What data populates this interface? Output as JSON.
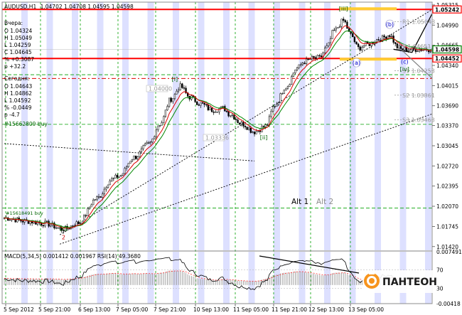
{
  "header": {
    "symbol": "AUDUSD,H1",
    "ohlc": "1.04702 1.04708 1.04595 1.04598"
  },
  "side_info": {
    "yesterday_label": "Вчера:",
    "yesterday": [
      "O 1.04324",
      "H 1.05049",
      "L 1.04259",
      "C 1.04645",
      "% +0.3087",
      "p +32.2"
    ],
    "today_label": "Сегодня:",
    "today": [
      "O 1.04643",
      "H 1.04862",
      "L 1.04592",
      "% -0.0449",
      "p -4.7"
    ],
    "order": "#15662809 buy",
    "order_small": "#15618491 buy",
    "box1": "1.04000",
    "box2": "1.03336"
  },
  "pivots": [
    {
      "label": "R1 1.05043",
      "value": 1.05043
    },
    {
      "label": "P 1.04651",
      "value": 1.04651
    },
    {
      "label": "S1 1.04253",
      "value": 1.04253
    },
    {
      "label": "S2 1.03861",
      "value": 1.03861
    },
    {
      "label": "S3 1.03463",
      "value": 1.03463
    }
  ],
  "waves": [
    {
      "text": "[i]",
      "color": "#006400",
      "bar": 92,
      "price": 1.0409
    },
    {
      "text": "[ii]",
      "color": "#006400",
      "bar": 140,
      "price": 1.0315
    },
    {
      "text": "[iii]",
      "color": "#006400",
      "bar": 183,
      "price": 1.0522
    },
    {
      "text": "(a)",
      "color": "#0000cc",
      "bar": 190,
      "price": 1.0435,
      "circle": true
    },
    {
      "text": "(b)",
      "color": "#0000cc",
      "bar": 208,
      "price": 1.0497,
      "circle": true
    },
    {
      "text": "(c)",
      "color": "#0000cc",
      "bar": 216,
      "price": 1.0437
    },
    {
      "text": "[iv]",
      "color": "#006400",
      "bar": 216,
      "price": 1.0425
    },
    {
      "text": "[c]",
      "color": "#006400",
      "bar": 32,
      "price": 1.0168
    },
    {
      "text": "2",
      "color": "#cc0000",
      "bar": 32,
      "price": 1.0154
    }
  ],
  "alt_labels": [
    {
      "text": "Alt 1",
      "color": "#000000"
    },
    {
      "text": "Alt 2",
      "color": "#8c8c8c"
    }
  ],
  "indicator_label": "MACD(5,34,5) 0.001412 0.001967  RSI(14) 49.3680",
  "logo_text": "ПАНТЕОН",
  "colors": {
    "bull_candle": "#ffffff",
    "bear_candle": "#000000",
    "ma_fast": "#dd0000",
    "ma_slow": "#008800",
    "resistance": "#ff0000",
    "bid_box": "#008000",
    "highlight": "#ffcc33",
    "session_band": "#dde0ff",
    "logo_orange": "#f7941d"
  },
  "chart_data": {
    "type": "candlestick",
    "symbol": "AUDUSD",
    "timeframe": "H1",
    "ylim": [
      1.0136,
      1.0536
    ],
    "y_ticks": [
      1.05315,
      1.0499,
      1.04665,
      1.0434,
      1.04015,
      1.0369,
      1.0337,
      1.03045,
      1.0272,
      1.02395,
      1.0207,
      1.01745,
      1.0142
    ],
    "x_ticks": [
      "5 Sep 2012",
      "5 Sep 21:00",
      "6 Sep 13:00",
      "7 Sep 05:00",
      "7 Sep 21:00",
      "10 Sep 13:00",
      "11 Sep 05:00",
      "11 Sep 21:00",
      "12 Sep 13:00",
      "13 Sep 05:00"
    ],
    "price_tags": [
      {
        "value": 1.05242,
        "label": "1.05242",
        "color": "#ff0000"
      },
      {
        "value": 1.04598,
        "label": "1.04598",
        "color": "#008000"
      },
      {
        "value": 1.04452,
        "label": "1.04452",
        "color": "#ff0000"
      }
    ],
    "horizontal_levels": [
      1.05242,
      1.04452
    ],
    "dashed_red_level": 1.0413,
    "green_dashed_levels": [
      1.0419,
      1.0339,
      1.0204
    ],
    "channel_upper": {
      "from": [
        30,
        1.0161
      ],
      "to": [
        232,
        1.0526
      ]
    },
    "channel_lower": {
      "from": [
        30,
        1.0146
      ],
      "to": [
        232,
        1.0357
      ]
    },
    "dotted_line": {
      "from": [
        0,
        1.0308
      ],
      "to": [
        135,
        1.028
      ]
    },
    "forecast_path": [
      [
        210,
        1.046
      ],
      [
        220,
        1.0455
      ],
      [
        232,
        1.0524
      ]
    ],
    "forecast_alt": [
      [
        214,
        1.046
      ],
      [
        232,
        1.041
      ]
    ],
    "anchor_points": [
      [
        0,
        1.0188
      ],
      [
        12,
        1.0183
      ],
      [
        22,
        1.0179
      ],
      [
        32,
        1.017
      ],
      [
        40,
        1.018
      ],
      [
        50,
        1.022
      ],
      [
        58,
        1.025
      ],
      [
        62,
        1.0256
      ],
      [
        70,
        1.0286
      ],
      [
        78,
        1.0307
      ],
      [
        84,
        1.034
      ],
      [
        90,
        1.038
      ],
      [
        95,
        1.04
      ],
      [
        100,
        1.0383
      ],
      [
        106,
        1.0372
      ],
      [
        112,
        1.0362
      ],
      [
        118,
        1.0365
      ],
      [
        122,
        1.0355
      ],
      [
        128,
        1.034
      ],
      [
        135,
        1.0327
      ],
      [
        141,
        1.0336
      ],
      [
        146,
        1.037
      ],
      [
        152,
        1.04
      ],
      [
        158,
        1.043
      ],
      [
        162,
        1.044
      ],
      [
        166,
        1.0445
      ],
      [
        170,
        1.0446
      ],
      [
        174,
        1.0463
      ],
      [
        178,
        1.049
      ],
      [
        183,
        1.0506
      ],
      [
        187,
        1.0483
      ],
      [
        191,
        1.0462
      ],
      [
        196,
        1.0468
      ],
      [
        202,
        1.0476
      ],
      [
        208,
        1.0483
      ],
      [
        212,
        1.0464
      ],
      [
        214,
        1.046
      ]
    ],
    "sub_ticks": [
      {
        "label": "0.007491",
        "value": 0.007491
      },
      {
        "label": "70",
        "value": 70
      },
      {
        "label": "30",
        "value": 30
      },
      {
        "label": "-0.00418",
        "value": -0.00418
      }
    ]
  }
}
